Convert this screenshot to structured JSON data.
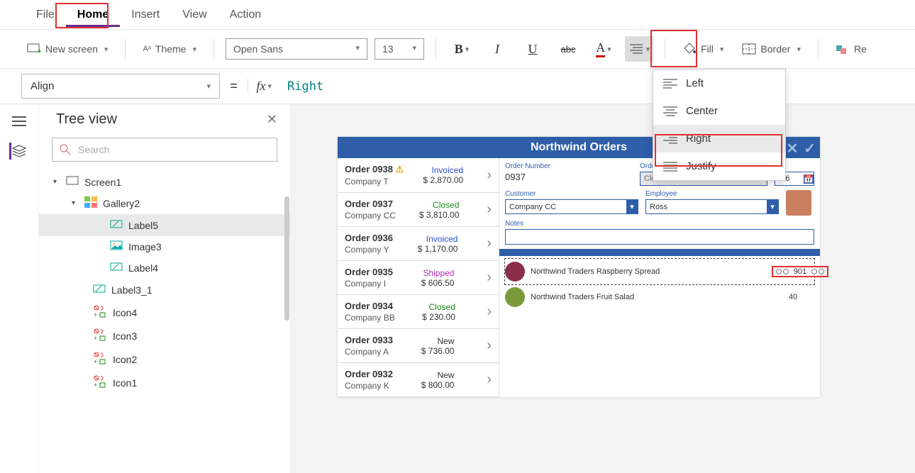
{
  "menu": {
    "file": "File",
    "home": "Home",
    "insert": "Insert",
    "view": "View",
    "action": "Action"
  },
  "ribbon": {
    "newScreen": "New screen",
    "theme": "Theme",
    "font": "Open Sans",
    "size": "13",
    "fill": "Fill",
    "border": "Border",
    "reuse": "Re"
  },
  "formula": {
    "prop": "Align",
    "fx": "fx",
    "value": "Right"
  },
  "treeview": {
    "title": "Tree view",
    "searchPlaceholder": "Search",
    "nodes": [
      {
        "id": "screen1",
        "label": "Screen1",
        "ind": 0,
        "exp": "▾",
        "icon": "screen"
      },
      {
        "id": "gallery2",
        "label": "Gallery2",
        "ind": 1,
        "exp": "▾",
        "icon": "gallery"
      },
      {
        "id": "label5",
        "label": "Label5",
        "ind": 2,
        "icon": "label",
        "sel": true
      },
      {
        "id": "image3",
        "label": "Image3",
        "ind": 2,
        "icon": "image"
      },
      {
        "id": "label4",
        "label": "Label4",
        "ind": 2,
        "icon": "label"
      },
      {
        "id": "label3_1",
        "label": "Label3_1",
        "ind": 1,
        "icon": "label",
        "inda": true
      },
      {
        "id": "icon4",
        "label": "Icon4",
        "ind": 1,
        "icon": "icons",
        "inda": true
      },
      {
        "id": "icon3",
        "label": "Icon3",
        "ind": 1,
        "icon": "icons",
        "inda": true
      },
      {
        "id": "icon2",
        "label": "Icon2",
        "ind": 1,
        "icon": "icons",
        "inda": true
      },
      {
        "id": "icon1",
        "label": "Icon1",
        "ind": 1,
        "icon": "icons",
        "inda": true
      }
    ]
  },
  "alignMenu": {
    "left": "Left",
    "center": "Center",
    "right": "Right",
    "justify": "Justify"
  },
  "app": {
    "title": "Northwind Orders",
    "orders": [
      {
        "num": "Order 0938",
        "warn": true,
        "company": "Company T",
        "status": "Invoiced",
        "stc": "inv",
        "amount": "$ 2,870.00"
      },
      {
        "num": "Order 0937",
        "company": "Company CC",
        "status": "Closed",
        "stc": "clo",
        "amount": "$ 3,810.00"
      },
      {
        "num": "Order 0936",
        "company": "Company Y",
        "status": "Invoiced",
        "stc": "inv",
        "amount": "$ 1,170.00"
      },
      {
        "num": "Order 0935",
        "company": "Company I",
        "status": "Shipped",
        "stc": "shp",
        "amount": "$ 606.50"
      },
      {
        "num": "Order 0934",
        "company": "Company BB",
        "status": "Closed",
        "stc": "clo",
        "amount": "$ 230.00"
      },
      {
        "num": "Order 0933",
        "company": "Company A",
        "status": "New",
        "stc": "new",
        "amount": "$ 736.00"
      },
      {
        "num": "Order 0932",
        "company": "Company K",
        "status": "New",
        "stc": "new",
        "amount": "$ 800.00"
      }
    ],
    "detail": {
      "orderNumLbl": "Order Number",
      "orderNum": "0937",
      "orderStatusLbl": "Order Status",
      "orderStatus": "Closed",
      "dateLbl": "ate",
      "date": "006",
      "customerLbl": "Customer",
      "customer": "Company CC",
      "employeeLbl": "Employee",
      "employee": "Ross",
      "notesLbl": "Notes",
      "products": [
        {
          "name": "Northwind Traders Raspberry Spread",
          "qty": "901",
          "sel": true,
          "color": "#8b2e4a"
        },
        {
          "name": "Northwind Traders Fruit Salad",
          "qty": "40",
          "sel": false,
          "color": "#7a9a3a"
        }
      ]
    }
  }
}
